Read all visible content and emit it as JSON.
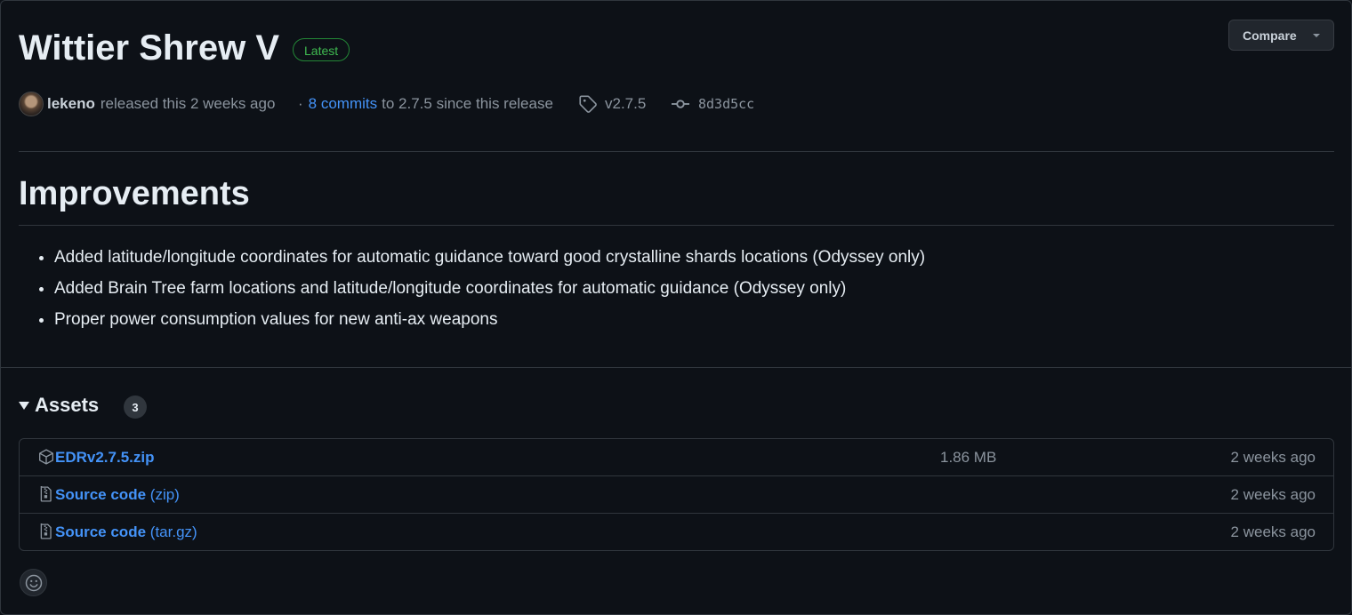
{
  "release": {
    "title": "Wittier Shrew V",
    "badge": "Latest",
    "compare_label": "Compare",
    "author": "lekeno",
    "released_text": "released this 2 weeks ago",
    "separator": "·",
    "commits_link": "8 commits",
    "commits_suffix": "to 2.7.5 since this release",
    "tag": "v2.7.5",
    "commit_sha": "8d3d5cc"
  },
  "notes": {
    "heading": "Improvements",
    "items": [
      "Added latitude/longitude coordinates for automatic guidance toward good crystalline shards locations (Odyssey only)",
      "Added Brain Tree farm locations and latitude/longitude coordinates for automatic guidance (Odyssey only)",
      "Proper power consumption values for new anti-ax weapons"
    ]
  },
  "assets": {
    "title": "Assets",
    "count": "3",
    "rows": [
      {
        "name": "EDRv2.7.5.zip",
        "sub": "",
        "size": "1.86 MB",
        "time": "2 weeks ago",
        "icon": "package-icon"
      },
      {
        "name": "Source code",
        "sub": "(zip)",
        "size": "",
        "time": "2 weeks ago",
        "icon": "file-zip-icon"
      },
      {
        "name": "Source code",
        "sub": "(tar.gz)",
        "size": "",
        "time": "2 weeks ago",
        "icon": "file-zip-icon"
      }
    ]
  },
  "colors": {
    "background": "#0d1117",
    "border": "#30363d",
    "link": "#4493f8",
    "badge_green": "#3fb950",
    "muted": "#8b949e"
  }
}
